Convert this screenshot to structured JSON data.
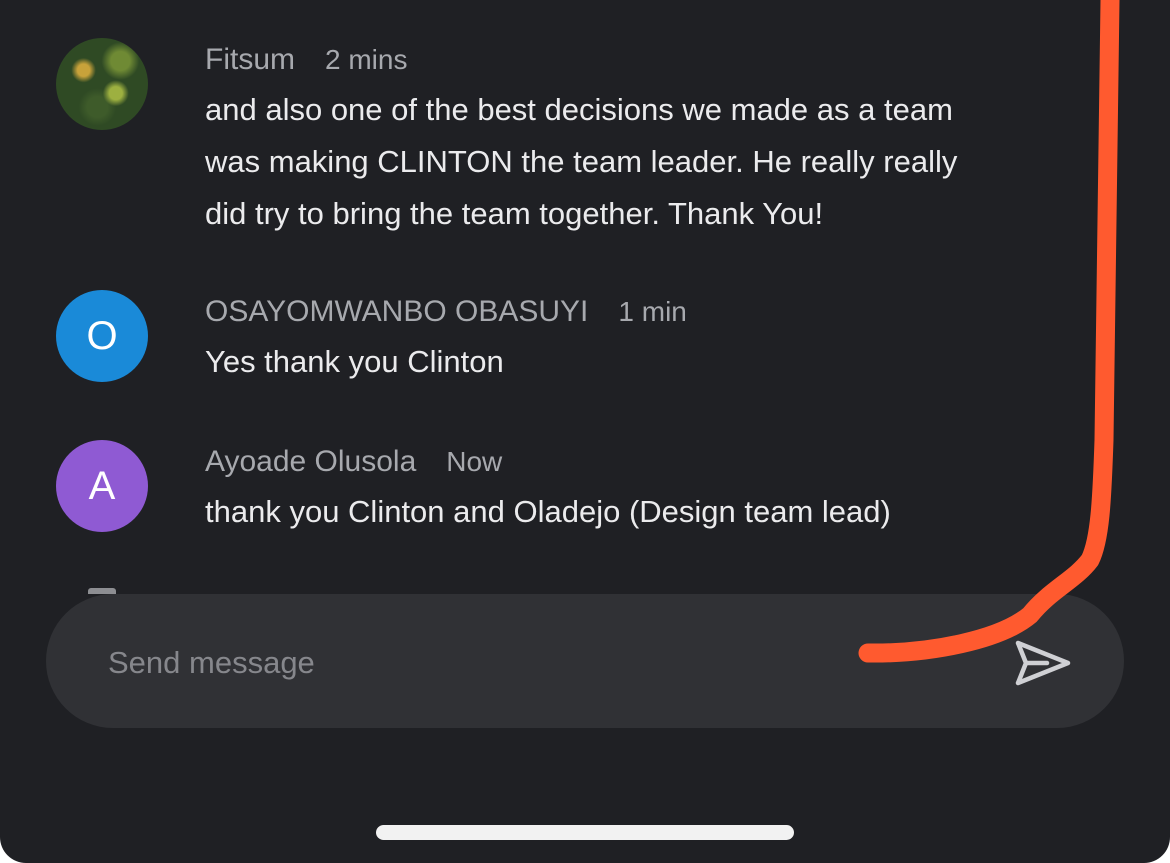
{
  "messages": [
    {
      "author": "Fitsum",
      "time": "2 mins",
      "avatar_type": "photo",
      "lines": [
        "and also one of the best decisions we made as a team",
        "was making CLINTON the team leader. He really really",
        "did try to bring the team together. Thank You!"
      ]
    },
    {
      "author": "OSAYOMWANBO OBASUYI",
      "time": "1 min",
      "avatar_type": "letter",
      "avatar_letter": "O",
      "avatar_color": "#1a8ad8",
      "lines": [
        "Yes thank you Clinton"
      ]
    },
    {
      "author": "Ayoade Olusola",
      "time": "Now",
      "avatar_type": "letter",
      "avatar_letter": "A",
      "avatar_color": "#8f5ad3",
      "lines": [
        "thank you Clinton  and Oladejo (Design team lead)"
      ]
    }
  ],
  "composer": {
    "placeholder": "Send message",
    "send_icon": "send-icon"
  },
  "annotation_color": "#ff5a2f",
  "colors": {
    "background": "#1f2024",
    "composer": "#303135",
    "meta_text": "#a7a9ae",
    "body_text": "#ebebed"
  }
}
